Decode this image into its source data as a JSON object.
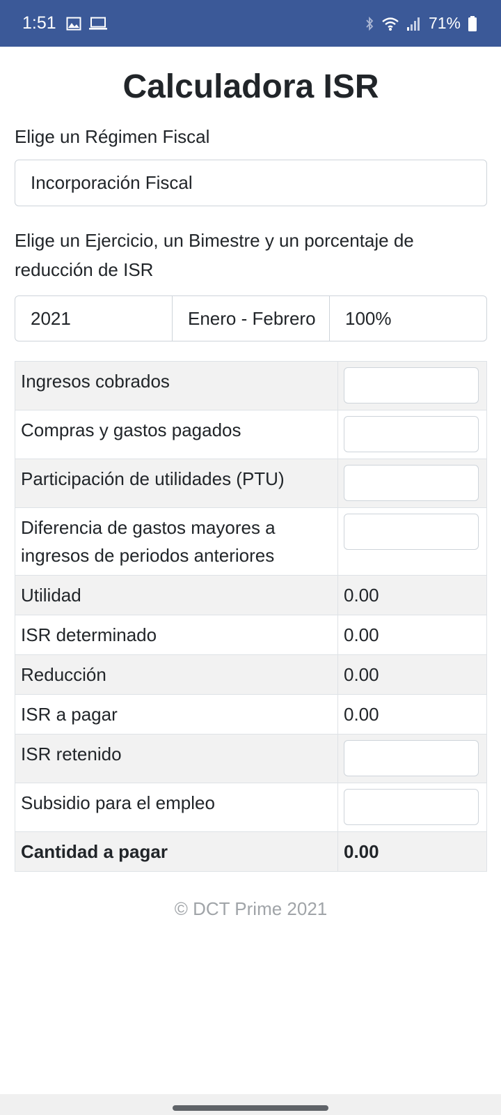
{
  "status": {
    "time": "1:51",
    "battery": "71%"
  },
  "title": "Calculadora ISR",
  "regimen_label": "Elige un Régimen Fiscal",
  "regimen_value": "Incorporación Fiscal",
  "period_label": "Elige un Ejercicio, un Bimestre y un porcentaje de reducción de ISR",
  "ejercicio": "2021",
  "bimestre": "Enero - Febrero",
  "porcentaje": "100%",
  "rows": {
    "ingresos": "Ingresos cobrados",
    "compras": "Compras y gastos pagados",
    "ptu": "Participación de utilidades (PTU)",
    "diferencia": "Diferencia de gastos mayores a ingresos de periodos anteriores",
    "utilidad": "Utilidad",
    "utilidad_val": "0.00",
    "isr_det": "ISR determinado",
    "isr_det_val": "0.00",
    "reduccion": "Reducción",
    "reduccion_val": "0.00",
    "isr_pagar": "ISR a pagar",
    "isr_pagar_val": "0.00",
    "isr_ret": "ISR retenido",
    "subsidio": "Subsidio para el empleo",
    "cantidad": "Cantidad a pagar",
    "cantidad_val": "0.00"
  },
  "footer": "© DCT Prime 2021",
  "icons": [
    "image-icon",
    "laptop-icon",
    "bluetooth-icon",
    "wifi-icon",
    "signal-icon",
    "battery-icon"
  ]
}
